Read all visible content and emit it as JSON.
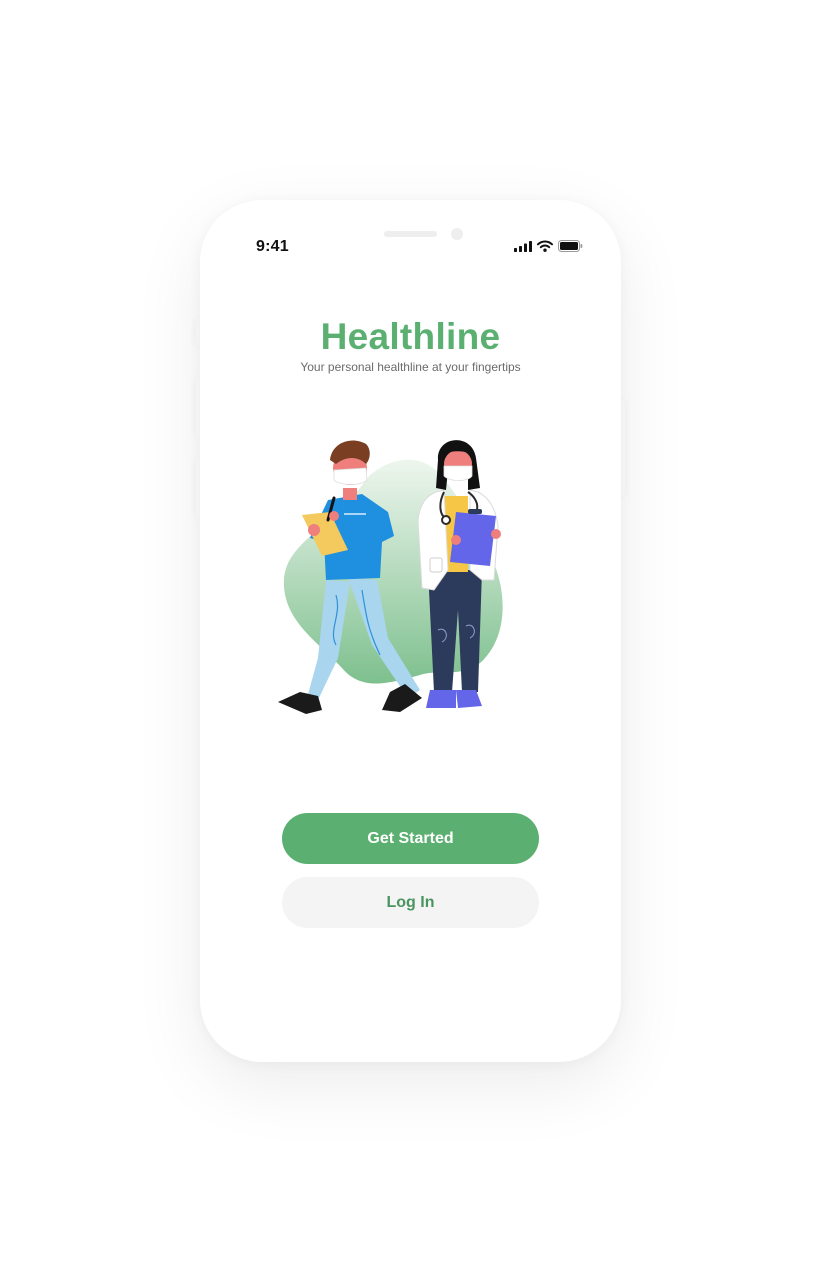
{
  "status_bar": {
    "time": "9:41",
    "icons": [
      "cellular-signal-icon",
      "wifi-icon",
      "battery-icon"
    ]
  },
  "app": {
    "title": "Healthline",
    "subtitle": "Your personal healthline at your fingertips"
  },
  "illustration": {
    "subject": "two-healthcare-workers-icon"
  },
  "actions": {
    "primary_label": "Get Started",
    "secondary_label": "Log In"
  },
  "colors": {
    "brand_green": "#5bb071",
    "secondary_button_bg": "#f4f4f4",
    "secondary_button_text": "#4a9460",
    "subtitle_text": "#6b6b6b"
  }
}
